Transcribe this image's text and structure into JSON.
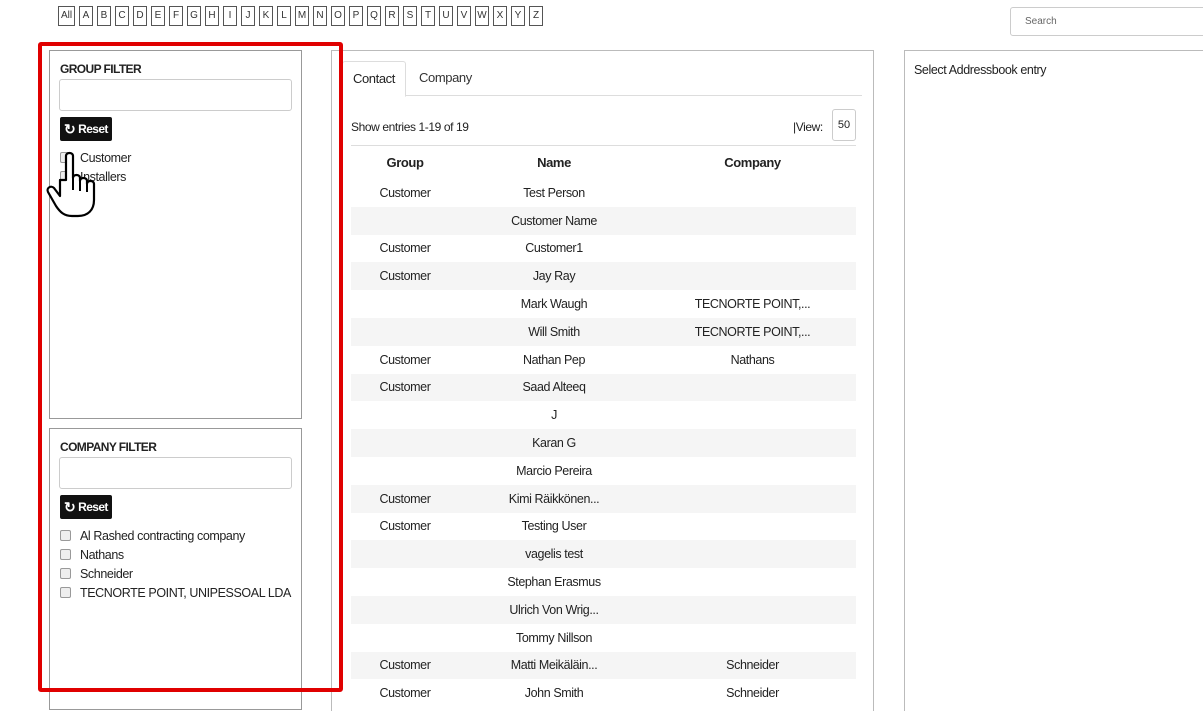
{
  "alphabet": [
    "All",
    "A",
    "B",
    "C",
    "D",
    "E",
    "F",
    "G",
    "H",
    "I",
    "J",
    "K",
    "L",
    "M",
    "N",
    "O",
    "P",
    "Q",
    "R",
    "S",
    "T",
    "U",
    "V",
    "W",
    "X",
    "Y",
    "Z"
  ],
  "search": {
    "placeholder": "Search"
  },
  "group_filter": {
    "title": "GROUP FILTER",
    "reset_label": "Reset",
    "items": [
      "Customer",
      "Installers"
    ]
  },
  "company_filter": {
    "title": "COMPANY FILTER",
    "reset_label": "Reset",
    "items": [
      "Al Rashed contracting company",
      "Nathans",
      "Schneider",
      "TECNORTE POINT, UNIPESSOAL LDA"
    ]
  },
  "tabs": [
    "Contact",
    "Company"
  ],
  "entries_text": "Show entries 1-19 of 19",
  "view_label": "|View:",
  "view_value": "50",
  "table": {
    "headers": [
      "Group",
      "Name",
      "Company"
    ],
    "rows": [
      [
        "Customer",
        "Test Person",
        ""
      ],
      [
        "",
        "Customer Name",
        ""
      ],
      [
        "Customer",
        "Customer1",
        ""
      ],
      [
        "Customer",
        "Jay Ray",
        ""
      ],
      [
        "",
        "Mark Waugh",
        "TECNORTE POINT,..."
      ],
      [
        "",
        "Will Smith",
        "TECNORTE POINT,..."
      ],
      [
        "Customer",
        "Nathan Pep",
        "Nathans"
      ],
      [
        "Customer",
        "Saad Alteeq",
        ""
      ],
      [
        "",
        "J",
        ""
      ],
      [
        "",
        "Karan G",
        ""
      ],
      [
        "",
        "Marcio Pereira",
        ""
      ],
      [
        "Customer",
        "Kimi Räikkönen...",
        ""
      ],
      [
        "Customer",
        "Testing User",
        ""
      ],
      [
        "",
        "vagelis test",
        ""
      ],
      [
        "",
        "Stephan Erasmus",
        ""
      ],
      [
        "",
        "Ulrich Von Wrig...",
        ""
      ],
      [
        "",
        "Tommy Nillson",
        ""
      ],
      [
        "Customer",
        "Matti Meikäläin...",
        "Schneider"
      ],
      [
        "Customer",
        "John Smith",
        "Schneider"
      ]
    ]
  },
  "right_panel": {
    "text": "Select Addressbook entry"
  },
  "colors": {
    "highlight": "#e00000",
    "reset_bg": "#111111",
    "row_stripe": "#f5f5f5"
  },
  "icons": {
    "reset": "refresh-icon",
    "cursor": "hand-pointer-icon"
  }
}
